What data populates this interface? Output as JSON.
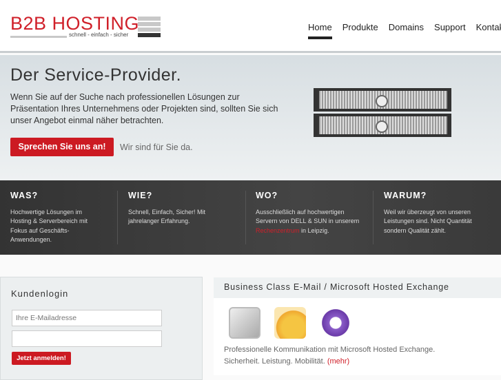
{
  "logo": {
    "text": "B2B HOSTING",
    "tagline": "schnell - einfach - sicher"
  },
  "nav": [
    "Home",
    "Produkte",
    "Domains",
    "Support",
    "Kontakt"
  ],
  "hero": {
    "title": "Der Service-Provider.",
    "text": "Wenn Sie auf der Suche nach professionellen Lösungen zur Präsentation Ihres Unternehmens oder Projekten sind, sollten Sie sich unser Angebot einmal näher betrachten.",
    "cta": "Sprechen Sie uns an!",
    "note": "Wir sind für Sie da."
  },
  "features": [
    {
      "title": "WAS?",
      "text": "Hochwertige Lösungen im Hosting & Serverbereich mit Fokus auf Geschäfts-Anwendungen."
    },
    {
      "title": "WIE?",
      "text": "Schnell, Einfach, Sicher! Mit jahrelanger Erfahrung."
    },
    {
      "title": "WO?",
      "pre": "Ausschließlich auf hochwertigen Servern von DELL & SUN in unserem ",
      "link": "Rechenzentrum",
      "post": " in Leipzig."
    },
    {
      "title": "WARUM?",
      "text": "Weil wir überzeugt von unseren Leistungen sind. Nicht Quantität sondern Qualität zählt."
    }
  ],
  "login": {
    "title": "Kundenlogin",
    "email_placeholder": "Ihre E-Mailadresse",
    "password_value": "",
    "button": "Jetzt anmelden!"
  },
  "panel": {
    "title": "Business Class E-Mail / Microsoft Hosted Exchange",
    "line1": "Professionelle Kommunikation mit Microsoft Hosted Exchange.",
    "line2": "Sicherheit. Leistung. Mobilität.",
    "more": "(mehr)"
  },
  "colors": {
    "accent": "#cc1a22"
  }
}
